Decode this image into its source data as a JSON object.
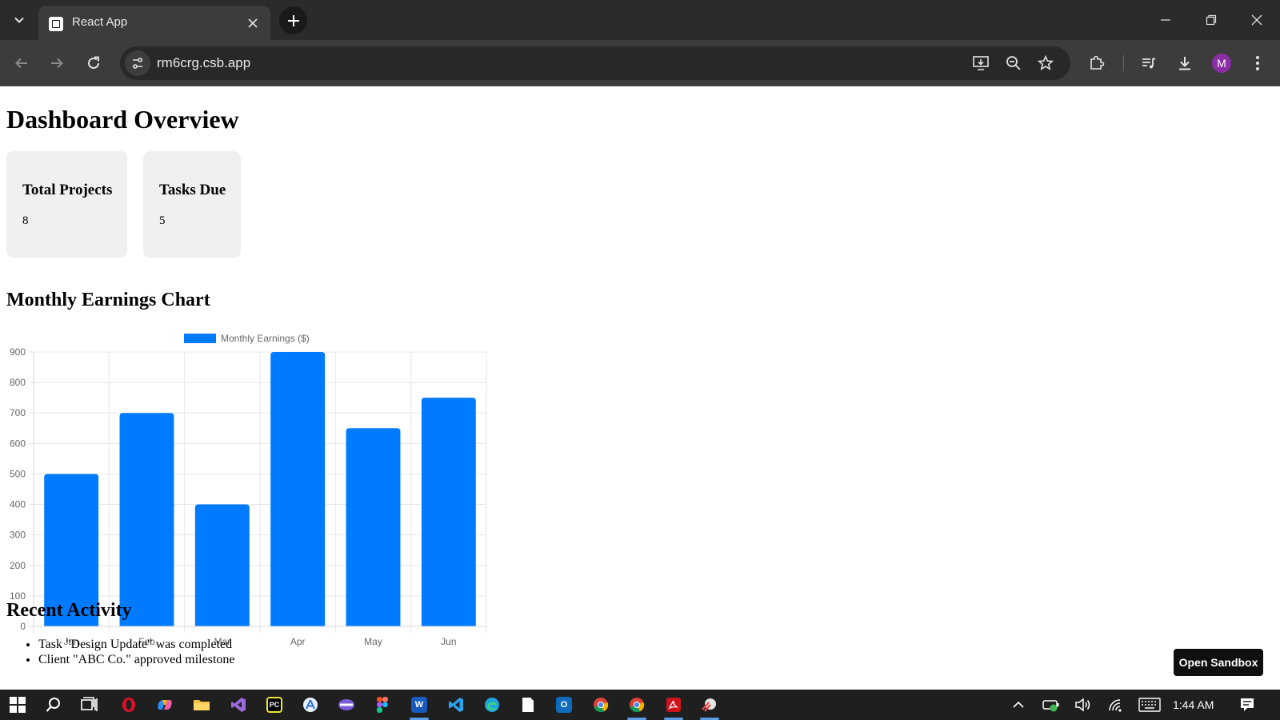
{
  "browser": {
    "tab_title": "React App",
    "url": "rm6crg.csb.app",
    "profile_initial": "M"
  },
  "page": {
    "title": "Dashboard Overview",
    "cards": [
      {
        "label": "Total Projects",
        "value": "8"
      },
      {
        "label": "Tasks Due",
        "value": "5"
      }
    ],
    "chart_heading": "Monthly Earnings Chart",
    "activity_heading": "Recent Activity",
    "activities": [
      "Task \"Design Update\" was completed",
      "Client \"ABC Co.\" approved milestone"
    ],
    "sandbox_button": "Open Sandbox"
  },
  "chart_data": {
    "type": "bar",
    "categories": [
      "Jan",
      "Feb",
      "Mar",
      "Apr",
      "May",
      "Jun"
    ],
    "series": [
      {
        "name": "Monthly Earnings ($)",
        "values": [
          500,
          700,
          400,
          900,
          650,
          750
        ],
        "color": "#007bff"
      }
    ],
    "ylim": [
      0,
      900
    ],
    "yticks": [
      0,
      100,
      200,
      300,
      400,
      500,
      600,
      700,
      800,
      900
    ],
    "grid": true,
    "legend": "top"
  },
  "taskbar": {
    "time": "1:44 AM"
  },
  "colors": {
    "accent": "#007bff",
    "tabbar": "#2b2b2b",
    "toolbar": "#3c3c3c",
    "card": "#f0f0f0",
    "taskbar": "#1f1f1f"
  }
}
